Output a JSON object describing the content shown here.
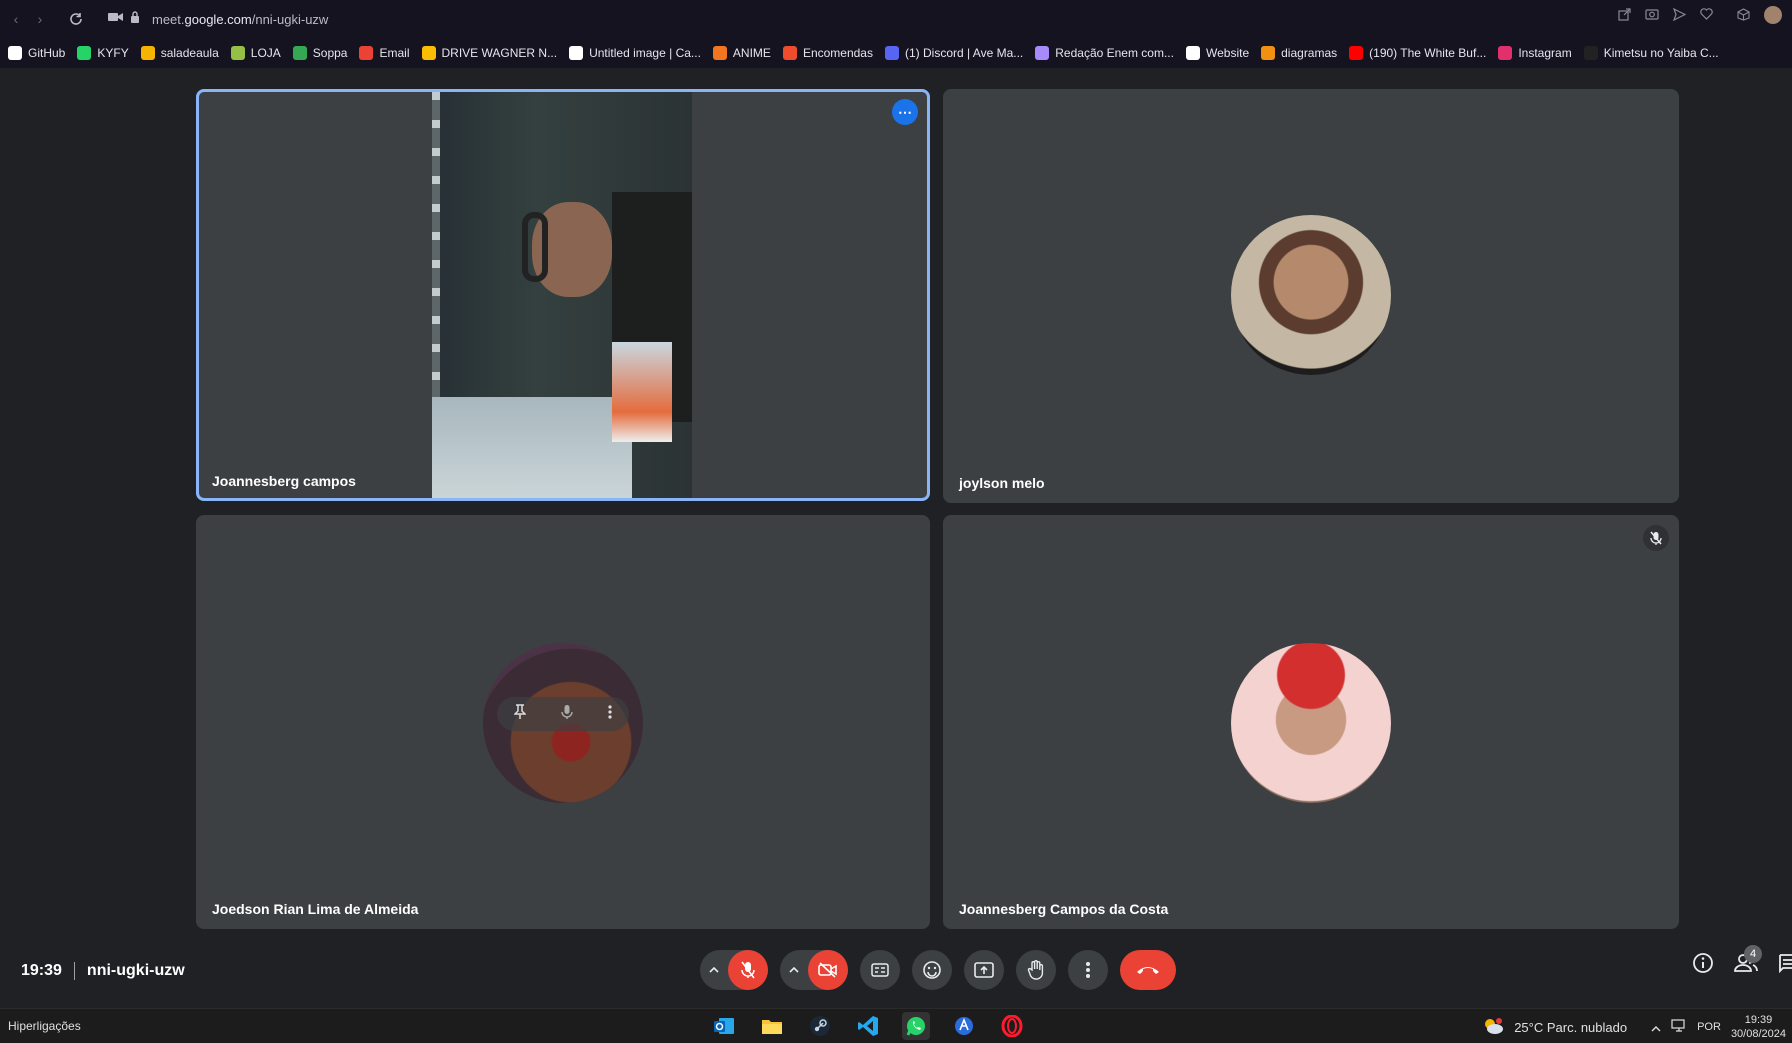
{
  "browser": {
    "url_prefix": "meet.",
    "url_domain": "google.com",
    "url_path": "/nni-ugki-uzw"
  },
  "bookmarks": [
    {
      "label": "GitHub",
      "color": "#ffffff"
    },
    {
      "label": "KYFY",
      "color": "#25d366"
    },
    {
      "label": "saladeaula",
      "color": "#f4b400"
    },
    {
      "label": "LOJA",
      "color": "#95bf47"
    },
    {
      "label": "Soppa",
      "color": "#34a853"
    },
    {
      "label": "Email",
      "color": "#ea4335"
    },
    {
      "label": "DRIVE WAGNER N...",
      "color": "#fbbc04"
    },
    {
      "label": "Untitled image | Ca...",
      "color": "#ffffff"
    },
    {
      "label": "ANIME",
      "color": "#f47521"
    },
    {
      "label": "Encomendas",
      "color": "#ee4d2d"
    },
    {
      "label": "(1) Discord | Ave Ma...",
      "color": "#5865f2"
    },
    {
      "label": "Redação Enem com...",
      "color": "#a78bfa"
    },
    {
      "label": "Website",
      "color": "#ffffff"
    },
    {
      "label": "diagramas",
      "color": "#f29111"
    },
    {
      "label": "(190) The White Buf...",
      "color": "#ff0000"
    },
    {
      "label": "Instagram",
      "color": "#e1306c"
    },
    {
      "label": "Kimetsu no Yaiba C...",
      "color": "#222222"
    }
  ],
  "tiles": [
    {
      "name": "Joannesberg campos"
    },
    {
      "name": "joylson melo"
    },
    {
      "name": "Joedson Rian Lima de Almeida"
    },
    {
      "name": "Joannesberg Campos da Costa"
    }
  ],
  "meeting": {
    "time": "19:39",
    "code": "nni-ugki-uzw",
    "participant_count": "4"
  },
  "taskbar": {
    "left_label": "Hiperligações",
    "weather": "25°C  Parc. nublado",
    "lang": "POR",
    "time": "19:39",
    "date": "30/08/2024"
  }
}
